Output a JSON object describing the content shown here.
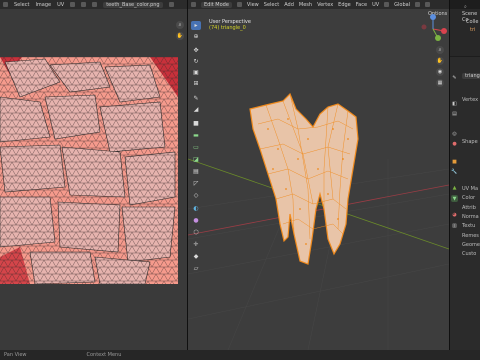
{
  "uv_header": {
    "menus": [
      "Select",
      "Image",
      "UV"
    ],
    "image_name": "teeth_Base_color.png"
  },
  "viewport_header": {
    "mode": "Edit Mode",
    "menus": [
      "View",
      "Select",
      "Add",
      "Mesh",
      "Vertex",
      "Edge",
      "Face",
      "UV"
    ],
    "transform": "Global",
    "options": "Options"
  },
  "viewport": {
    "view_name": "User Perspective",
    "object_info": "(74) triangle_0"
  },
  "outliner": {
    "title": "Scene Co",
    "items": [
      "Colle",
      "tri"
    ]
  },
  "properties": {
    "search_text": "triang",
    "rows": [
      "Vertex",
      "Shape",
      "UV Ma",
      "Color",
      "Attrib",
      "Norma",
      "Textu",
      "Remes",
      "Geome",
      "Custo"
    ]
  },
  "status_bar": {
    "left": "Pan View",
    "middle": "Context Menu"
  },
  "colors": {
    "accent": "#4772b3",
    "selection_orange": "#f08a1c",
    "uv_image": "#f59a8c"
  },
  "icons": {
    "tools": [
      "cursor-icon",
      "move-icon",
      "rotate-icon",
      "scale-icon",
      "transform-icon",
      "annotate-icon",
      "measure-icon",
      "add-cube-icon",
      "extrude-icon",
      "inset-icon",
      "bevel-icon",
      "loopcut-icon",
      "knife-icon",
      "polybuild-icon",
      "spin-icon",
      "smooth-icon",
      "edge-slide-icon",
      "shrink-icon",
      "shear-icon",
      "rip-icon"
    ]
  }
}
